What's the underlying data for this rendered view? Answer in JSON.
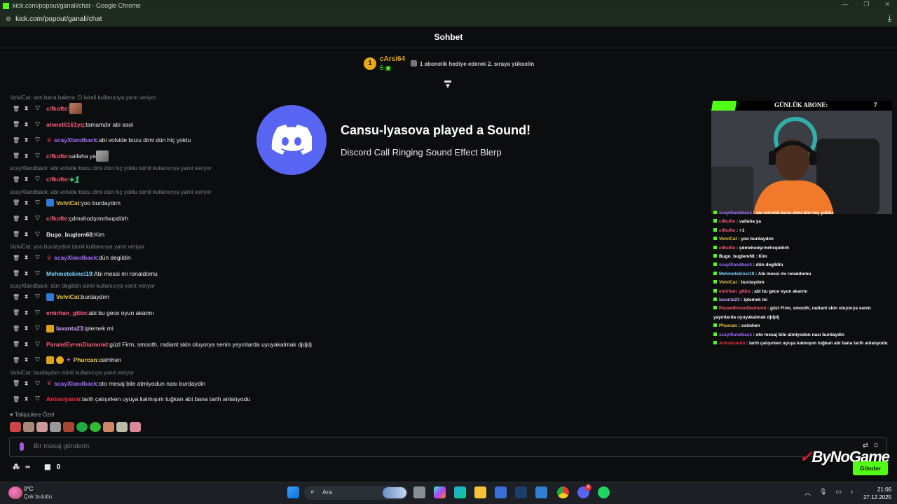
{
  "browser": {
    "title": "kick.com/popout/ganali/chat - Google Chrome",
    "url": "kick.com/popout/ganali/chat"
  },
  "chat": {
    "header": "Sohbet",
    "pinned": {
      "rank": "1",
      "user": "cArsi64",
      "count": "5",
      "hint": "1 abonelik hediye ederek 2. sıraya yükselin"
    },
    "lines": [
      {
        "type": "reply",
        "text": "VolviCat: sen bana bakma :D isimli kullanıcıya yanıt veriyor"
      },
      {
        "type": "msg",
        "user": "cifkofte",
        "color": "#ff5c7a",
        "badges": [],
        "message": "",
        "emote": "img"
      },
      {
        "type": "msg",
        "user": "ahmet6161yq",
        "color": "#ff5c7a",
        "badges": [],
        "message": "tamamdır abi saol"
      },
      {
        "type": "msg",
        "user": "scayXlandback",
        "color": "#a66bff",
        "badges": [
          "red"
        ],
        "message": "abi volvide bozu dimi dün hiç yoktu"
      },
      {
        "type": "msg",
        "user": "cifkofte",
        "color": "#ff5c7a",
        "badges": [],
        "message": "vallaha ya",
        "emote": "cat"
      },
      {
        "type": "reply",
        "text": "scayXlandback: abi volvide bozu dimi dün hiç yoktu isimli kullanıcıya yanıt veriyor"
      },
      {
        "type": "msg",
        "user": "cifkofte",
        "color": "#ff5c7a",
        "badges": [],
        "message": "",
        "emote": "plus1"
      },
      {
        "type": "reply",
        "text": "scayXlandback: abi volvide bozu dimi dün hiç yoktu isimli kullanıcıya yanıt veriyor"
      },
      {
        "type": "msg",
        "user": "VolviCat",
        "color": "#f0c94a",
        "badges": [
          "blue"
        ],
        "message": "yoo burdaydım"
      },
      {
        "type": "msg",
        "user": "cifkofte",
        "color": "#ff5c7a",
        "badges": [],
        "message": "çdmxhodşrmrhxıpdörh"
      },
      {
        "type": "msg",
        "user": "Bugo_buglem68",
        "color": "#e6e6e6",
        "badges": [],
        "message": "Kim"
      },
      {
        "type": "reply",
        "text": "VolviCat: yoo burdaydım isimli kullanıcıya yanıt veriyor"
      },
      {
        "type": "msg",
        "user": "scayXlandback",
        "color": "#a66bff",
        "badges": [
          "red"
        ],
        "message": "dün degildin"
      },
      {
        "type": "msg",
        "user": "Mehmetekinci19",
        "color": "#7fd3ff",
        "badges": [],
        "message": "Abi messi mi ronaldomu"
      },
      {
        "type": "reply",
        "text": "scayXlandback: dün degildin isimli kullanıcıya yanıt veriyor"
      },
      {
        "type": "msg",
        "user": "VolviCat",
        "color": "#f0c94a",
        "badges": [
          "blue"
        ],
        "message": "burdaydım"
      },
      {
        "type": "msg",
        "user": "emirhan_gltkn",
        "color": "#ff5c7a",
        "badges": [],
        "message": "abi bu gece oyun akarmı"
      },
      {
        "type": "msg",
        "user": "lavanta23",
        "color": "#d0a0ff",
        "badges": [
          "gold"
        ],
        "message": "iplemek mi"
      },
      {
        "type": "msg",
        "user": "ParalelEvrenDiamond",
        "color": "#ff5c7a",
        "badges": [],
        "message": "güzl Firm, smooth, radiant skin oluyorya senin yayınlarda uyuyakalmak djdjdj"
      },
      {
        "type": "msg",
        "user": "Phurcan",
        "color": "#f0c94a",
        "badges": [
          "gold",
          "coin",
          "purple"
        ],
        "message": "osimhen"
      },
      {
        "type": "reply",
        "text": "VolviCat: burdaydım isimli kullanıcıya yanıt veriyor"
      },
      {
        "type": "msg",
        "user": "scayXlandback",
        "color": "#a66bff",
        "badges": [
          "red"
        ],
        "message": "oto mesaj bile atmiyodun nası burdaydin"
      },
      {
        "type": "msg",
        "user": "Antoslyanin",
        "color": "#ff3040",
        "badges": [],
        "message": "tarih çalışırken uyuya kalmışım tuğkan abi bana tarih anlatıyodu"
      }
    ],
    "follower_label": "Takipçilere Özel",
    "input_placeholder": "Bir mesaj gönderin",
    "viewers": "∞",
    "stat_count": "0",
    "send_label": "Gönder"
  },
  "overlay": {
    "discord_title": "Cansu-lyasova played a Sound!",
    "discord_sub": "Discord Call Ringing Sound Effect Blerp",
    "goal_label": "GÜNLÜK ABONE:",
    "goal_current": "1",
    "goal_value": "7",
    "goal_progress": 0.14,
    "brand": "ByNoGame"
  },
  "mini_chat": [
    {
      "user": "scayXlandback",
      "msg": "abi volvide bozu dimi dün hiç yoktu",
      "color": "#a66bff"
    },
    {
      "user": "cifkofte",
      "msg": "vallaha ya",
      "color": "#ff5c7a"
    },
    {
      "user": "cifkofte",
      "msg": "+1",
      "color": "#ff5c7a"
    },
    {
      "user": "VolviCat",
      "msg": "yoo burdaydım",
      "color": "#f0c94a"
    },
    {
      "user": "cifkofte",
      "msg": "çdmxhodşrmrhxıpdörh",
      "color": "#ff5c7a"
    },
    {
      "user": "Bugo_buglem68",
      "msg": "Kim",
      "color": "#ffffff"
    },
    {
      "user": "scayXlandback",
      "msg": "dün degildin",
      "color": "#a66bff"
    },
    {
      "user": "Mehmetekinci19",
      "msg": "Abi messi mi ronaldomu",
      "color": "#7fd3ff"
    },
    {
      "user": "VolviCat",
      "msg": "burdaydım",
      "color": "#f0c94a"
    },
    {
      "user": "emirhan_gltkn",
      "msg": "abi bu gece oyun akarmı",
      "color": "#ff5c7a"
    },
    {
      "user": "lavanta23",
      "msg": "iplemek mi",
      "color": "#d0a0ff"
    },
    {
      "user": "ParalelEvrenDiamond",
      "msg": "güzl Firm, smooth, radiant skin oluyorya senin",
      "color": "#ff5c7a"
    },
    {
      "user": "",
      "msg": "yayınlarda uyuyakalmak djdjdj",
      "color": "#ffffff"
    },
    {
      "user": "Phurcan",
      "msg": "osimhen",
      "color": "#f0c94a"
    },
    {
      "user": "scayXlandback",
      "msg": "oto mesaj bile atmiyodun nası burdaydin",
      "color": "#a66bff"
    },
    {
      "user": "Antoslyanin",
      "msg": "tarih çalışırken uyuya kalmışım tuğkan abi bana tarih anlatıyodu",
      "color": "#ff3040"
    }
  ],
  "taskbar": {
    "temp": "0°C",
    "weather": "Çok bulutlu",
    "search": "Ara",
    "time": "21:06",
    "date": "27.12.2025",
    "discord_badge": "9"
  },
  "icons": {
    "mod_delete": "trash-icon",
    "mod_timeout": "hourglass-icon",
    "mod_ban": "shield-icon"
  }
}
